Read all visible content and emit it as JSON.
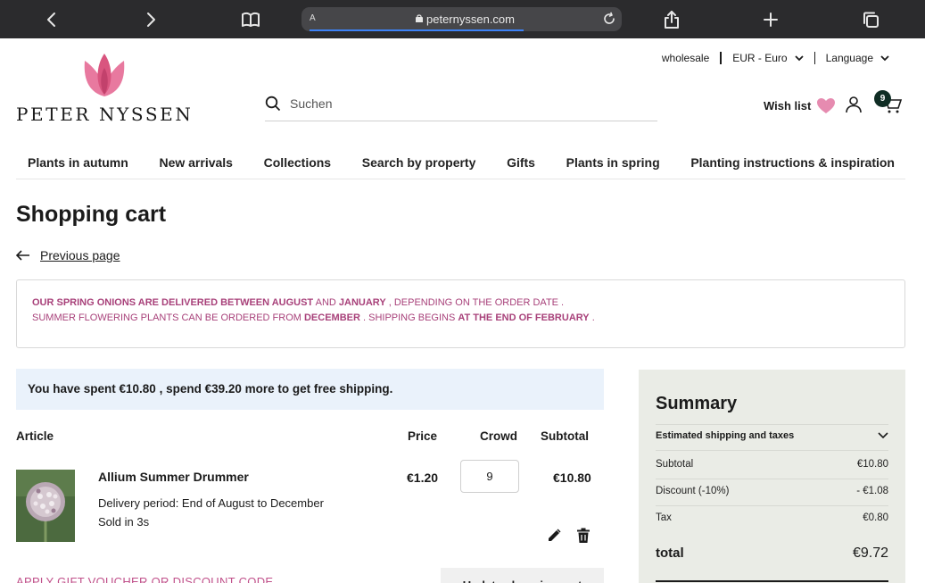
{
  "browser": {
    "text_size_label": "A",
    "url": "peternyssen.com"
  },
  "header": {
    "brand": "PETER NYSSEN",
    "wholesale": "wholesale",
    "currency": "EUR - Euro",
    "language": "Language",
    "search_placeholder": "Suchen",
    "wishlist": "Wish list",
    "cart_count": "9"
  },
  "nav": [
    "Plants in autumn",
    "New arrivals",
    "Collections",
    "Search by property",
    "Gifts",
    "Plants in spring",
    "Planting instructions & inspiration"
  ],
  "page": {
    "title": "Shopping cart",
    "back_label": "Previous page"
  },
  "notice": {
    "l1_a": "OUR SPRING ONIONS ARE DELIVERED BETWEEN AUGUST",
    "l1_b": " AND ",
    "l1_c": "JANUARY",
    "l1_d": " , DEPENDING ON THE ORDER DATE .",
    "l2_a": "SUMMER FLOWERING PLANTS CAN BE ORDERED FROM ",
    "l2_b": "DECEMBER",
    "l2_c": " . SHIPPING BEGINS ",
    "l2_d": "AT THE END OF FEBRUARY",
    "l2_e": " ."
  },
  "shipping_message": "You have spent €10.80 , spend €39.20 more to get free shipping.",
  "table": {
    "headers": {
      "article": "Article",
      "price": "Price",
      "crowd": "Crowd",
      "subtotal": "Subtotal"
    },
    "items": [
      {
        "name": "Allium Summer Drummer",
        "delivery": "Delivery period: End of August to December",
        "sold": "Sold in 3s",
        "price": "€1.20",
        "qty": "9",
        "subtotal": "€10.80"
      }
    ]
  },
  "gift_link": "APPLY GIFT VOUCHER OR DISCOUNT CODE",
  "update_button": "Update shopping cart",
  "summary": {
    "title": "Summary",
    "estimate_label": "Estimated shipping and taxes",
    "rows": [
      {
        "label": "Subtotal",
        "value": "€10.80"
      },
      {
        "label": "Discount (-10%)",
        "value": "- €1.08"
      },
      {
        "label": "Tax",
        "value": "€0.80"
      }
    ],
    "total_label": "total",
    "total_value": "€9.72"
  },
  "colors": {
    "brand_pink": "#a8417a",
    "chrome_bg": "#2b2b2d",
    "badge_green": "#0f2d24",
    "summary_bg": "#eaece6",
    "ship_bg": "#eaf2fb"
  }
}
